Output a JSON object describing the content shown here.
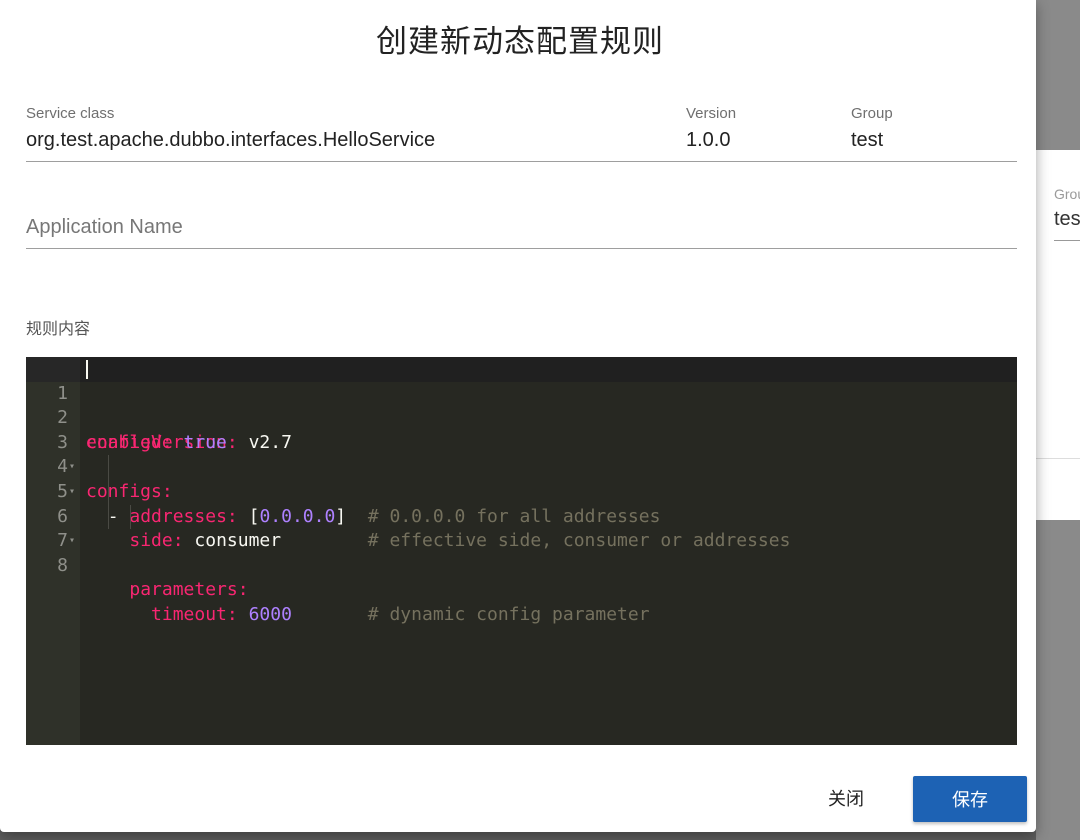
{
  "background": {
    "group_label": "Grou",
    "group_value": "tes"
  },
  "dialog": {
    "title": "创建新动态配置规则",
    "service_class": {
      "label": "Service class",
      "value": "org.test.apache.dubbo.interfaces.HelloService"
    },
    "version": {
      "label": "Version",
      "value": "1.0.0"
    },
    "group": {
      "label": "Group",
      "value": "test"
    },
    "application_name": {
      "placeholder": "Application Name"
    },
    "rule_content_label": "规则内容",
    "editor": {
      "line_numbers": [
        "1",
        "2",
        "3",
        "4",
        "5",
        "6",
        "7",
        "8"
      ],
      "lines": {
        "l1_key": "configVersion:",
        "l1_val": "v2.7",
        "l2_key": "enabled:",
        "l2_val": "true",
        "l3_key": "configs:",
        "l4_dash": "- ",
        "l4_key": "addresses:",
        "l4_open": "[",
        "l4_val": "0.0.0.0",
        "l4_close": "]",
        "l4_comment": "# 0.0.0.0 for all addresses",
        "l5_key": "side:",
        "l5_val": "consumer",
        "l5_comment": "# effective side, consumer or addresses",
        "l6_key": "parameters:",
        "l7_key": "timeout:",
        "l7_val": "6000",
        "l7_comment": "# dynamic config parameter"
      }
    },
    "buttons": {
      "close": "关闭",
      "save": "保存"
    }
  },
  "colors": {
    "primary": "#1d62b4",
    "editor_bg": "#272822",
    "keyword": "#f92672",
    "number": "#ae81ff",
    "comment": "#75715e"
  },
  "icons": {
    "fold": "fold-arrow-icon"
  }
}
